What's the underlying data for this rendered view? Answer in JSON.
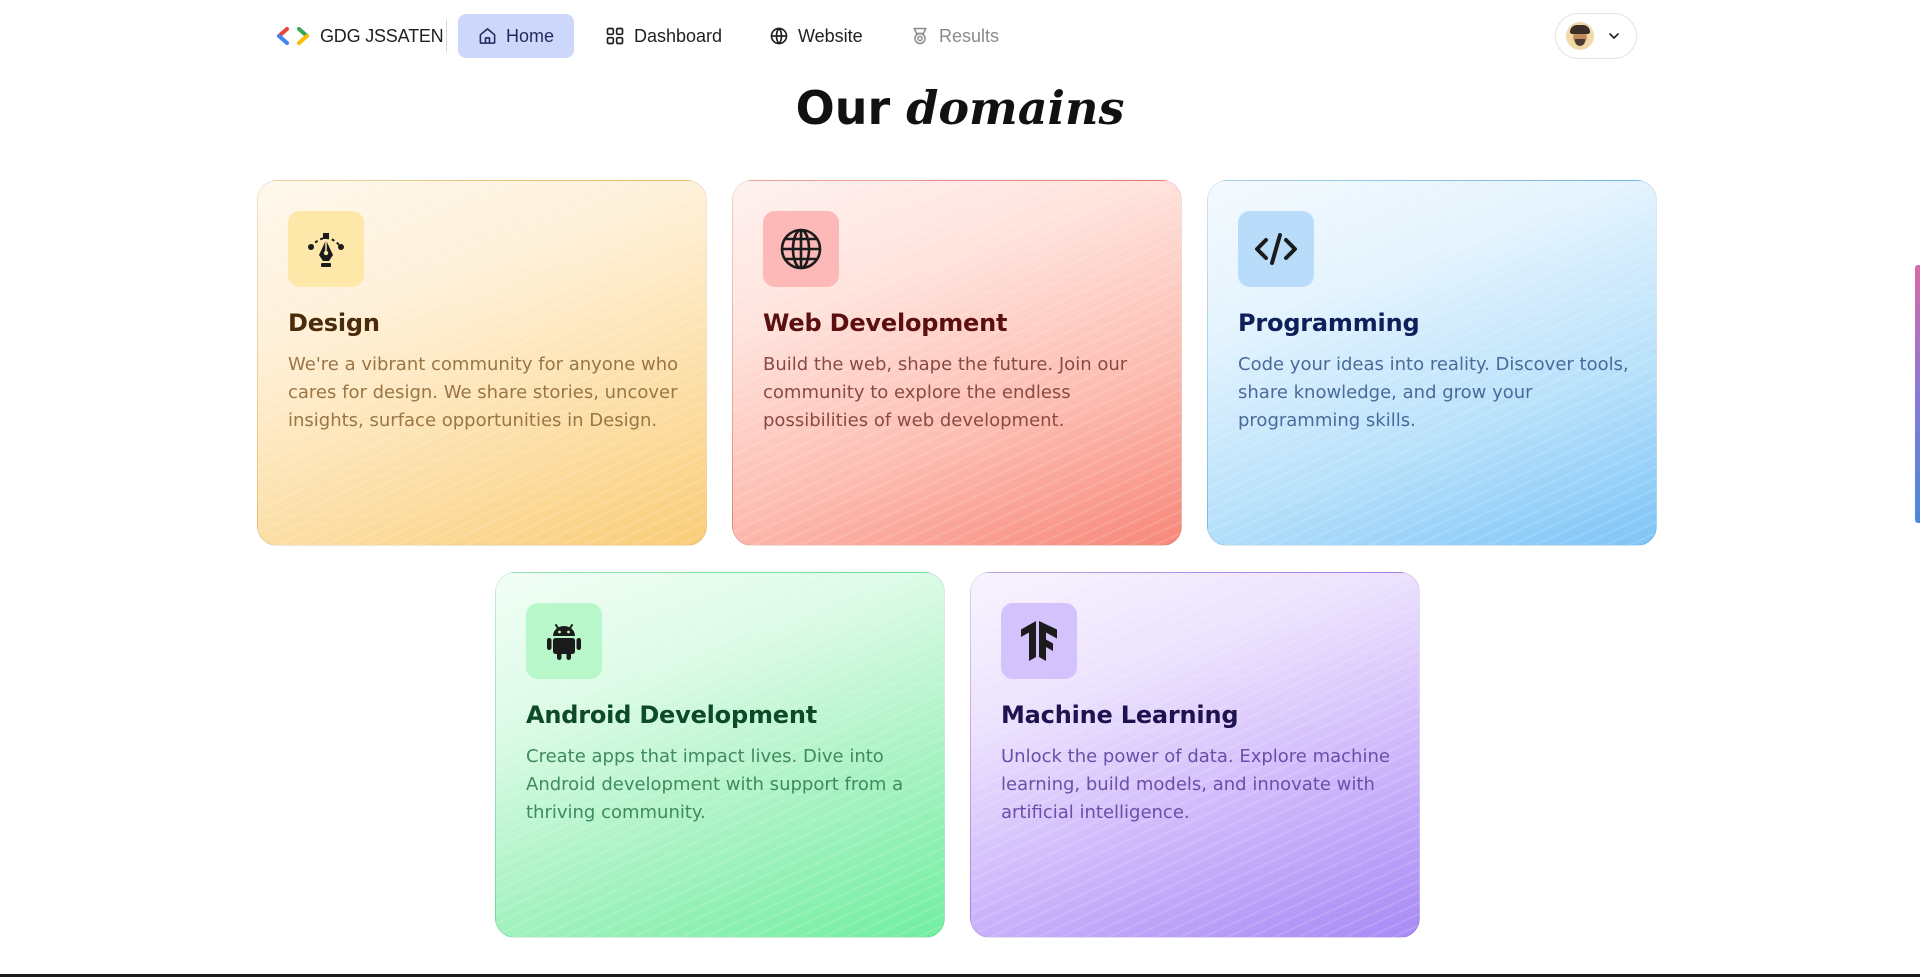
{
  "nav": {
    "brand": "GDG JSSATEN",
    "items": [
      {
        "label": "Home",
        "icon": "home-icon",
        "active": true
      },
      {
        "label": "Dashboard",
        "icon": "dashboard-icon",
        "active": false
      },
      {
        "label": "Website",
        "icon": "globe-icon",
        "active": false
      },
      {
        "label": "Results",
        "icon": "trophy-icon",
        "active": false,
        "muted": true
      }
    ],
    "user_menu_icon": "chevron-down-icon"
  },
  "section": {
    "title_plain": "Our",
    "title_italic": "domains"
  },
  "domains": [
    {
      "title": "Design",
      "icon": "pen-tool-icon",
      "description": "We're a vibrant community for anyone who cares for design. We share stories, uncover insights, surface opportunities in Design.",
      "color": "#f9cd78"
    },
    {
      "title": "Web Development",
      "icon": "globe-icon",
      "description": "Build the web, shape the future. Join our community to explore the endless possibilities of web development.",
      "color": "#f7877a"
    },
    {
      "title": "Programming",
      "icon": "code-icon",
      "description": "Code your ideas into reality. Discover tools, share knowledge, and grow your programming skills.",
      "color": "#7ec4f7"
    },
    {
      "title": "Android Development",
      "icon": "android-icon",
      "description": "Create apps that impact lives. Dive into Android development with support from a thriving community.",
      "color": "#71eea0"
    },
    {
      "title": "Machine Learning",
      "icon": "tensorflow-icon",
      "description": "Unlock the power of data. Explore machine learning, build models, and innovate with artificial intelligence.",
      "color": "#a88af5"
    }
  ]
}
